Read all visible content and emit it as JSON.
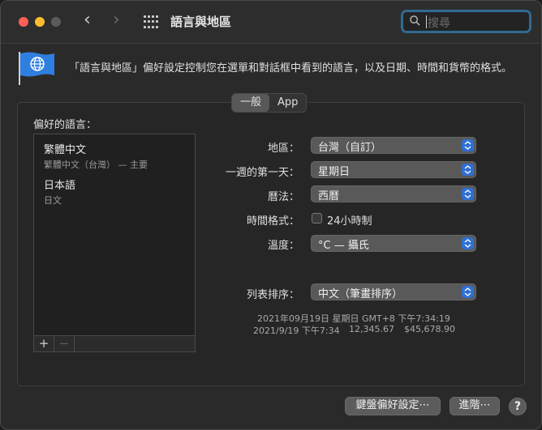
{
  "window": {
    "title": "語言與地區"
  },
  "nav": {
    "back": "‹",
    "forward": "›"
  },
  "search": {
    "placeholder": "搜尋"
  },
  "header": {
    "description": "「語言與地區」偏好設定控制您在選單和對話框中看到的語言，以及日期、時間和貨幣的格式。"
  },
  "tabs": [
    {
      "label": "一般",
      "active": true
    },
    {
      "label": "App",
      "active": false
    }
  ],
  "preferred_languages": {
    "label": "偏好的語言：",
    "items": [
      {
        "name": "繁體中文",
        "detail": "繁體中文（台灣） — 主要"
      },
      {
        "name": "日本語",
        "detail": "日文"
      }
    ],
    "add": "+",
    "remove": "−"
  },
  "settings": {
    "region": {
      "label": "地區：",
      "value": "台灣（自訂）"
    },
    "first_day": {
      "label": "一週的第一天：",
      "value": "星期日"
    },
    "calendar": {
      "label": "曆法：",
      "value": "西曆"
    },
    "time_format": {
      "label": "時間格式：",
      "checkbox_label": "24小時制",
      "checked": false
    },
    "temperature": {
      "label": "溫度：",
      "value": "°C — 攝氏"
    },
    "list_sort": {
      "label": "列表排序：",
      "value": "中文（筆畫排序）"
    }
  },
  "sample": {
    "line1": "2021年09月19日 星期日 GMT+8 下午7:34:19",
    "date_short": "2021/9/19 下午7:34",
    "number": "12,345.67",
    "currency": "$45,678.90"
  },
  "buttons": {
    "keyboard": "鍵盤偏好設定⋯",
    "advanced": "進階⋯",
    "help": "?"
  },
  "colors": {
    "accent": "#2f6fd4",
    "search_focus": "#2f6a94"
  }
}
